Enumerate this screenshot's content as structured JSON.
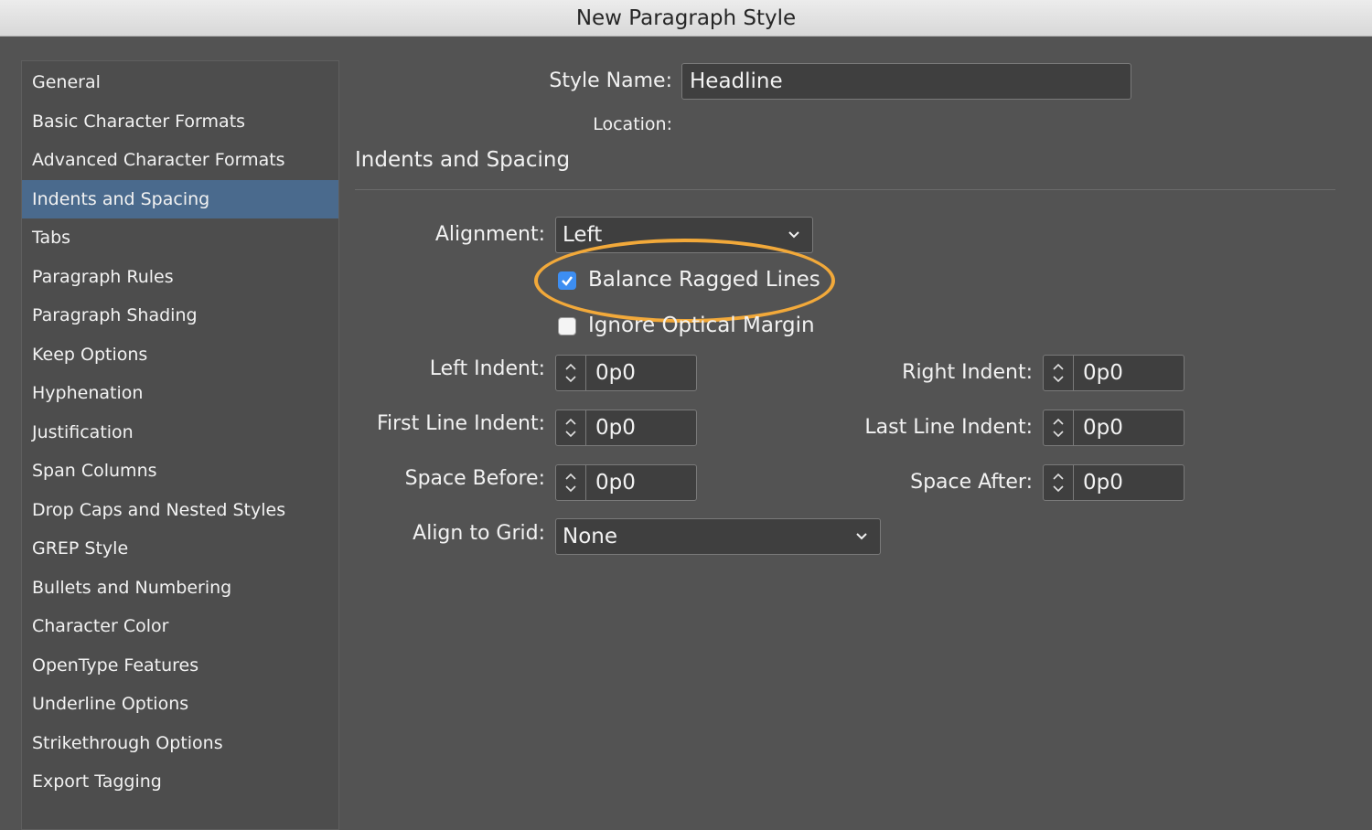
{
  "window": {
    "title": "New Paragraph Style"
  },
  "sidebar": {
    "items": [
      {
        "label": "General"
      },
      {
        "label": "Basic Character Formats"
      },
      {
        "label": "Advanced Character Formats"
      },
      {
        "label": "Indents and Spacing",
        "selected": true
      },
      {
        "label": "Tabs"
      },
      {
        "label": "Paragraph Rules"
      },
      {
        "label": "Paragraph Shading"
      },
      {
        "label": "Keep Options"
      },
      {
        "label": "Hyphenation"
      },
      {
        "label": "Justification"
      },
      {
        "label": "Span Columns"
      },
      {
        "label": "Drop Caps and Nested Styles"
      },
      {
        "label": "GREP Style"
      },
      {
        "label": "Bullets and Numbering"
      },
      {
        "label": "Character Color"
      },
      {
        "label": "OpenType Features"
      },
      {
        "label": "Underline Options"
      },
      {
        "label": "Strikethrough Options"
      },
      {
        "label": "Export Tagging"
      }
    ]
  },
  "header": {
    "style_name_label": "Style Name:",
    "style_name_value": "Headline",
    "location_label": "Location:"
  },
  "section": {
    "title": "Indents and Spacing"
  },
  "alignment": {
    "label": "Alignment:",
    "value": "Left"
  },
  "balance_ragged_lines": {
    "label": "Balance Ragged Lines",
    "checked": true
  },
  "ignore_optical_margin": {
    "label": "Ignore Optical Margin",
    "checked": false
  },
  "left_indent": {
    "label": "Left Indent:",
    "value": "0p0"
  },
  "right_indent": {
    "label": "Right Indent:",
    "value": "0p0"
  },
  "first_line_indent": {
    "label": "First Line Indent:",
    "value": "0p0"
  },
  "last_line_indent": {
    "label": "Last Line Indent:",
    "value": "0p0"
  },
  "space_before": {
    "label": "Space Before:",
    "value": "0p0"
  },
  "space_after": {
    "label": "Space After:",
    "value": "0p0"
  },
  "align_to_grid": {
    "label": "Align to Grid:",
    "value": "None"
  },
  "colors": {
    "dialog_bg": "#535353",
    "selected_item": "#4a6a8d",
    "checkbox_checked": "#3d8ef2",
    "highlight": "#f2a93a"
  },
  "icons": [
    "chevron-down-icon",
    "stepper-up-icon",
    "stepper-down-icon",
    "checkmark-icon"
  ]
}
